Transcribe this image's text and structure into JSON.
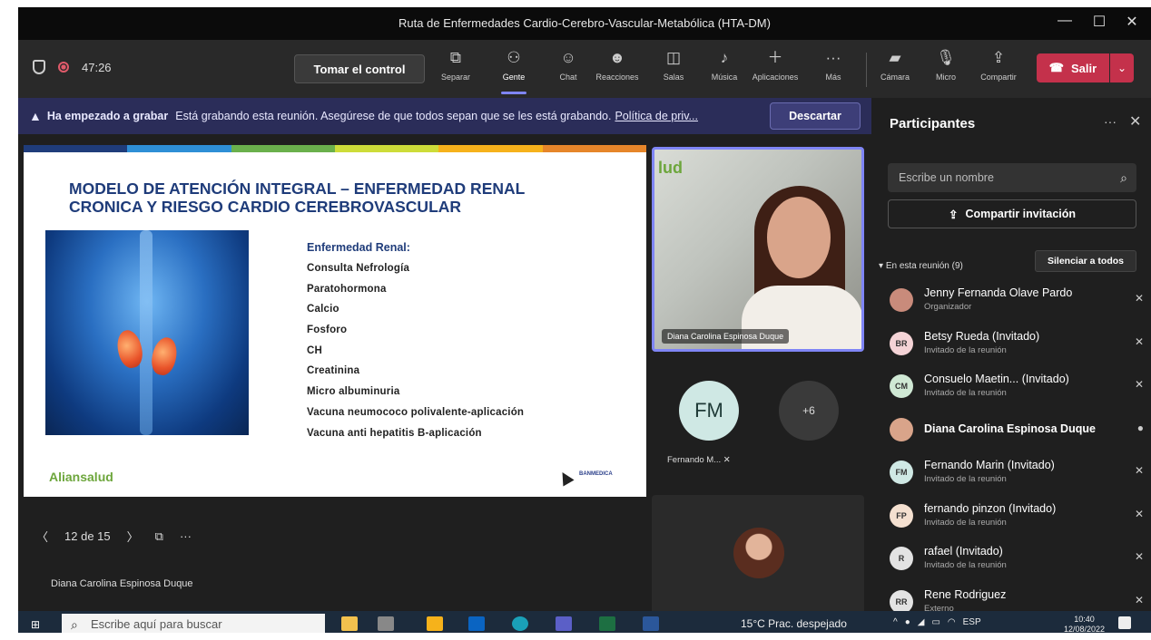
{
  "window": {
    "title": "Ruta de Enfermedades Cardio-Cerebro-Vascular-Metabólica (HTA-DM)"
  },
  "toolbar": {
    "timer": "47:26",
    "take_control": "Tomar el control",
    "buttons": [
      {
        "label": "Separar",
        "icon": "pop-out-icon"
      },
      {
        "label": "Gente",
        "icon": "people-icon"
      },
      {
        "label": "Chat",
        "icon": "chat-icon"
      },
      {
        "label": "Reacciones",
        "icon": "reactions-icon"
      },
      {
        "label": "Salas",
        "icon": "rooms-icon"
      },
      {
        "label": "Música",
        "icon": "music-icon"
      },
      {
        "label": "Aplicaciones",
        "icon": "apps-icon"
      },
      {
        "label": "Más",
        "icon": "more-icon"
      }
    ],
    "camera": "Cámara",
    "mic": "Micro",
    "share": "Compartir",
    "leave": "Salir"
  },
  "banner": {
    "bold": "Ha empezado a grabar",
    "text": "Está grabando esta reunión. Asegúrese de que todos sepan que se les está grabando.",
    "link": "Política de priv...",
    "dismiss": "Descartar"
  },
  "slide": {
    "title_line1": "MODELO DE ATENCIÓN INTEGRAL – ENFERMEDAD RENAL",
    "title_line2": "CRONICA Y RIESGO CARDIO CEREBROVASCULAR",
    "list_heading": "Enfermedad Renal:",
    "items": [
      "Consulta Nefrología",
      "Paratohormona",
      "Calcio",
      "Fosforo",
      "CH",
      "Creatinina",
      "Micro albuminuria",
      "Vacuna neumococo polivalente-aplicación",
      "Vacuna anti hepatitis B-aplicación"
    ],
    "logo_left": "Aliansalud",
    "logo_right": "BANMEDICA",
    "stripe_colors": [
      "#1f3c7a",
      "#2e8fd6",
      "#6ab04c",
      "#cddc39",
      "#f6b21b",
      "#e6862a"
    ]
  },
  "slide_nav": {
    "counter": "12 de 15",
    "presenter": "Diana Carolina Espinosa Duque"
  },
  "videos": {
    "main_name": "Diana Carolina Espinosa Duque",
    "main_logo": "lud",
    "fm_initials": "FM",
    "fm_label": "Fernando M...",
    "more_count": "+6"
  },
  "panel": {
    "title": "Participantes",
    "search_placeholder": "Escribe un nombre",
    "invite": "Compartir invitación",
    "section": "En esta reunión (9)",
    "mute_all": "Silenciar a todos",
    "participants": [
      {
        "initials": "",
        "name": "Jenny Fernanda Olave Pardo",
        "role": "Organizador",
        "color": "#c98b7b"
      },
      {
        "initials": "BR",
        "name": "Betsy Rueda (Invitado)",
        "role": "Invitado de la reunión",
        "color": "#f4d3d6"
      },
      {
        "initials": "CM",
        "name": "Consuelo Maetin... (Invitado)",
        "role": "Invitado de la reunión",
        "color": "#cfe8d4"
      },
      {
        "initials": "",
        "name": "Diana Carolina Espinosa Duque",
        "role": "",
        "color": "#d9a48a"
      },
      {
        "initials": "FM",
        "name": "Fernando Marin (Invitado)",
        "role": "Invitado de la reunión",
        "color": "#cfe8e4"
      },
      {
        "initials": "FP",
        "name": "fernando pinzon (Invitado)",
        "role": "Invitado de la reunión",
        "color": "#f4e0d0"
      },
      {
        "initials": "R",
        "name": "rafael (Invitado)",
        "role": "Invitado de la reunión",
        "color": "#e3e3e3"
      },
      {
        "initials": "RR",
        "name": "Rene Rodriguez",
        "role": "Externo",
        "color": "#e3e3e3"
      }
    ]
  },
  "taskbar": {
    "search": "Escribe aquí para buscar",
    "weather": "15°C  Prac. despejado",
    "lang": "ESP",
    "time": "10:40",
    "date": "12/08/2022"
  },
  "colors": {
    "accent": "#7f85f5",
    "leave": "#c4314b",
    "banner": "#2b2d59"
  }
}
